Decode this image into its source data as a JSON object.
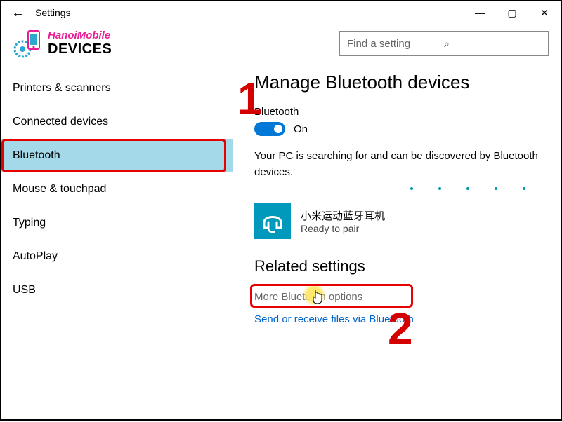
{
  "titlebar": {
    "title": "Settings"
  },
  "header": {
    "brand": "HanoiMobile",
    "devices_label": "DEVICES",
    "search_placeholder": "Find a setting"
  },
  "sidebar": {
    "items": [
      {
        "label": "Printers & scanners"
      },
      {
        "label": "Connected devices"
      },
      {
        "label": "Bluetooth"
      },
      {
        "label": "Mouse & touchpad"
      },
      {
        "label": "Typing"
      },
      {
        "label": "AutoPlay"
      },
      {
        "label": "USB"
      }
    ]
  },
  "main": {
    "heading": "Manage Bluetooth devices",
    "bt_label": "Bluetooth",
    "toggle_state": "On",
    "status_text": "Your PC is searching for and can be discovered by Bluetooth devices.",
    "device": {
      "name": "小米运动蓝牙耳机",
      "status": "Ready to pair"
    },
    "related_heading": "Related settings",
    "link_more": "More Bluetooth options",
    "link_files": "Send or receive files via Bluetooth"
  },
  "annotations": {
    "one": "1",
    "two": "2"
  }
}
